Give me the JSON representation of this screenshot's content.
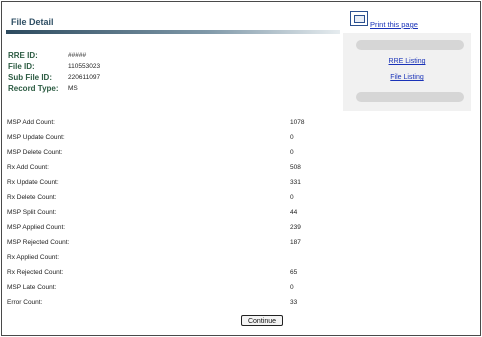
{
  "header": {
    "title": "File Detail"
  },
  "print": {
    "label": "Print this page",
    "icon": "print-icon"
  },
  "side_links": {
    "rre_listing": "RRE Listing",
    "file_listing": "File Listing"
  },
  "meta": [
    {
      "label": "RRE ID:",
      "value": "#####"
    },
    {
      "label": "File ID:",
      "value": "110553023"
    },
    {
      "label": "Sub File ID:",
      "value": "220611097"
    },
    {
      "label": "Record Type:",
      "value": "MS"
    }
  ],
  "counts": [
    {
      "label": "MSP Add Count:",
      "value": "1078"
    },
    {
      "label": "MSP Update Count:",
      "value": "0"
    },
    {
      "label": "MSP Delete Count:",
      "value": "0"
    },
    {
      "label": "Rx Add Count:",
      "value": "508"
    },
    {
      "label": "Rx Update Count:",
      "value": "331"
    },
    {
      "label": "Rx Delete Count:",
      "value": "0"
    },
    {
      "label": "MSP Split Count:",
      "value": "44"
    },
    {
      "label": "MSP Applied Count:",
      "value": "239"
    },
    {
      "label": "MSP Rejected Count:",
      "value": "187"
    },
    {
      "label": "Rx Applied Count:",
      "value": ""
    },
    {
      "label": "Rx Rejected Count:",
      "value": "65"
    },
    {
      "label": "MSP Late Count:",
      "value": "0"
    },
    {
      "label": "Error Count:",
      "value": "33"
    }
  ],
  "actions": {
    "continue_label": "Continue"
  },
  "colors": {
    "label_green": "#2d5c43",
    "link_blue": "#1a33b8",
    "header_dark": "#2c4a5e"
  }
}
